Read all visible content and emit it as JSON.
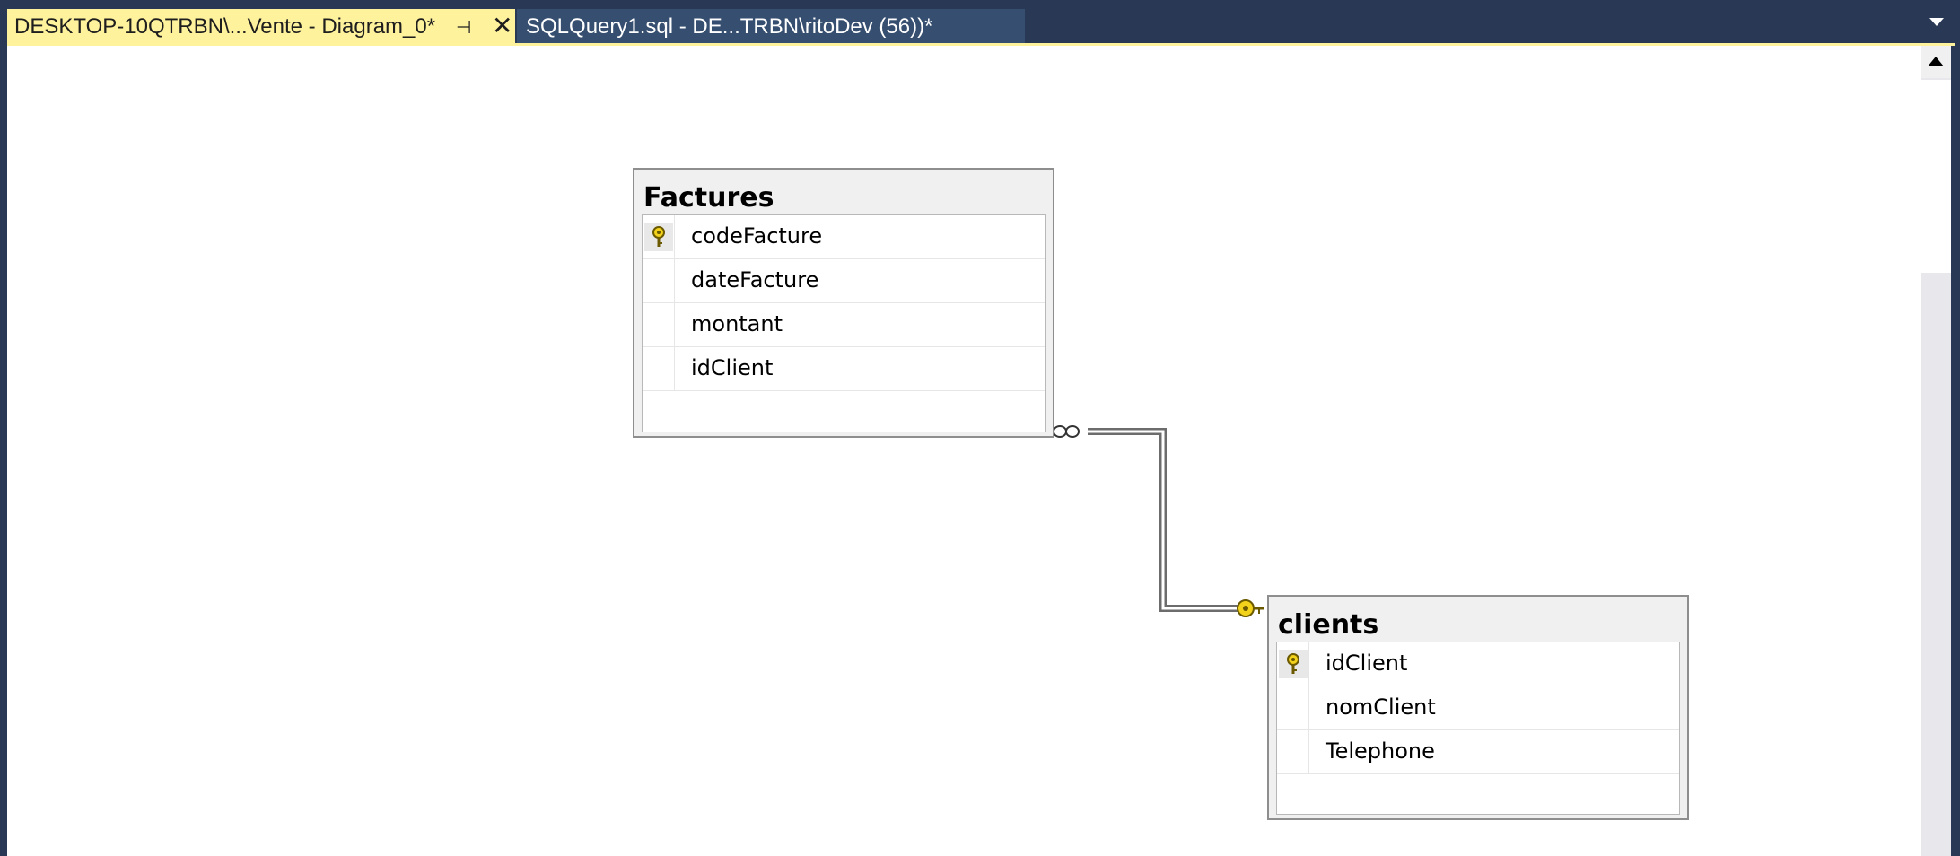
{
  "tabs": {
    "active_label": "DESKTOP-10QTRBN\\...Vente - Diagram_0*",
    "pin_glyph": "⊣",
    "close_glyph": "✕",
    "inactive_label": "SQLQuery1.sql - DE...TRBN\\ritoDev (56))*"
  },
  "diagram": {
    "tables": [
      {
        "name": "Factures",
        "columns": [
          {
            "name": "codeFacture",
            "primary_key": true
          },
          {
            "name": "dateFacture",
            "primary_key": false
          },
          {
            "name": "montant",
            "primary_key": false
          },
          {
            "name": "idClient",
            "primary_key": false
          }
        ]
      },
      {
        "name": "clients",
        "columns": [
          {
            "name": "idClient",
            "primary_key": true
          },
          {
            "name": "nomClient",
            "primary_key": false
          },
          {
            "name": "Telephone",
            "primary_key": false
          }
        ]
      }
    ],
    "relationship": {
      "from_table": "Factures",
      "to_table": "clients",
      "from_end": "many-infinity-icon",
      "to_end": "key-icon"
    }
  },
  "colors": {
    "tab_bar": "#293955",
    "active_tab": "#fff29d",
    "key_gold": "#f2d21b",
    "canvas": "#ffffff"
  }
}
